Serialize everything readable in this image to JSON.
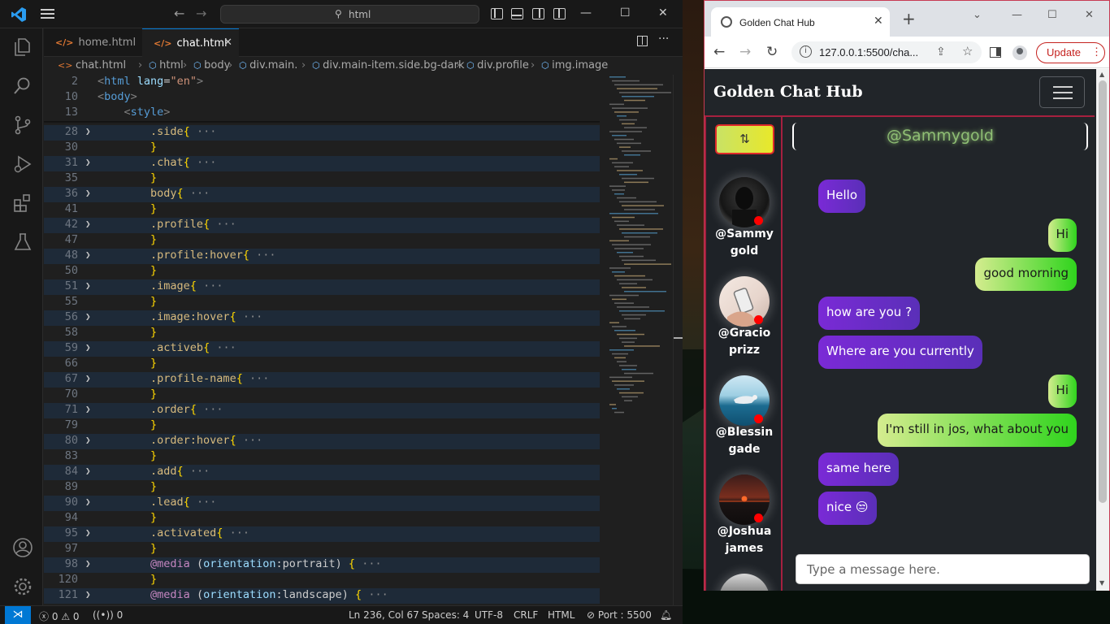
{
  "vscode": {
    "search_text": "html",
    "tabs": [
      {
        "label": "home.html"
      },
      {
        "label": "chat.html"
      }
    ],
    "breadcrumb": [
      "chat.html",
      "html",
      "body",
      "div.main.",
      "div.main-item.side.bg-dark",
      "div.profile",
      "img.image"
    ],
    "sticky": [
      {
        "num": "2",
        "code": "<html lang=\"en\">"
      },
      {
        "num": "10",
        "code": "<body>"
      },
      {
        "num": "13",
        "code": "<style>"
      }
    ],
    "lines": [
      {
        "num": "28",
        "text": ".side{",
        "fold": true
      },
      {
        "num": "30",
        "text": "}",
        "fold": false
      },
      {
        "num": "31",
        "text": ".chat{",
        "fold": true
      },
      {
        "num": "35",
        "text": "}",
        "fold": false
      },
      {
        "num": "36",
        "text": "body{",
        "fold": true
      },
      {
        "num": "41",
        "text": "}",
        "fold": false
      },
      {
        "num": "42",
        "text": ".profile{",
        "fold": true
      },
      {
        "num": "47",
        "text": "}",
        "fold": false
      },
      {
        "num": "48",
        "text": ".profile:hover{",
        "fold": true
      },
      {
        "num": "50",
        "text": "}",
        "fold": false
      },
      {
        "num": "51",
        "text": ".image{",
        "fold": true
      },
      {
        "num": "55",
        "text": "}",
        "fold": false
      },
      {
        "num": "56",
        "text": ".image:hover{",
        "fold": true
      },
      {
        "num": "58",
        "text": "}",
        "fold": false
      },
      {
        "num": "59",
        "text": ".activeb{",
        "fold": true
      },
      {
        "num": "66",
        "text": "}",
        "fold": false
      },
      {
        "num": "67",
        "text": ".profile-name{",
        "fold": true
      },
      {
        "num": "70",
        "text": "}",
        "fold": false
      },
      {
        "num": "71",
        "text": ".order{",
        "fold": true
      },
      {
        "num": "79",
        "text": "}",
        "fold": false
      },
      {
        "num": "80",
        "text": ".order:hover{",
        "fold": true
      },
      {
        "num": "83",
        "text": "}",
        "fold": false
      },
      {
        "num": "84",
        "text": ".add{",
        "fold": true
      },
      {
        "num": "89",
        "text": "}",
        "fold": false
      },
      {
        "num": "90",
        "text": ".lead{",
        "fold": true
      },
      {
        "num": "94",
        "text": "}",
        "fold": false
      },
      {
        "num": "95",
        "text": ".activated{",
        "fold": true
      },
      {
        "num": "97",
        "text": "}",
        "fold": false
      },
      {
        "num": "98",
        "text": "@media (orientation:portrait) {",
        "fold": true
      },
      {
        "num": "120",
        "text": "}",
        "fold": false
      },
      {
        "num": "121",
        "text": "@media (orientation:landscape) {",
        "fold": true
      }
    ],
    "fold_ellipsis": "···",
    "status": {
      "errors": "0",
      "warnings": "0",
      "ports": "0",
      "position": "Ln 236, Col 67",
      "spaces": "Spaces: 4",
      "encoding": "UTF-8",
      "eol": "CRLF",
      "language": "HTML",
      "port": "Port : 5500"
    }
  },
  "chrome": {
    "tab_title": "Golden Chat Hub",
    "url": "127.0.0.1:5500/cha...",
    "update_label": "Update"
  },
  "app": {
    "brand": "Golden Chat Hub",
    "order_icon": "⇅",
    "chat_header": "@Sammygold",
    "profiles": [
      {
        "line1": "@Sammy",
        "line2": "gold",
        "avatar": "dark-portrait"
      },
      {
        "line1": "@Gracio",
        "line2": "prizz",
        "avatar": "phone-in-hand"
      },
      {
        "line1": "@Blessin",
        "line2": "gade",
        "avatar": "bird-on-sea"
      },
      {
        "line1": "@Joshua",
        "line2": "james",
        "avatar": "sunset"
      }
    ],
    "messages": [
      {
        "text": "Hello",
        "dir": "in"
      },
      {
        "text": "Hi",
        "dir": "out"
      },
      {
        "text": "good morning",
        "dir": "out"
      },
      {
        "text": "how are you ?",
        "dir": "in"
      },
      {
        "text": "Where are you currently",
        "dir": "in"
      },
      {
        "text": "Hi",
        "dir": "out"
      },
      {
        "text": "I'm still in jos, what about you",
        "dir": "out"
      },
      {
        "text": "same here",
        "dir": "in"
      },
      {
        "text": "nice 😒",
        "dir": "in"
      }
    ],
    "input_placeholder": "Type a message here."
  }
}
